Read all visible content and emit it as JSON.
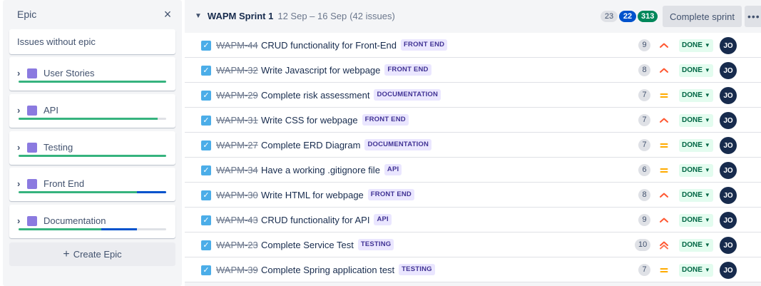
{
  "epic_panel": {
    "title": "Epic",
    "close_icon": "×",
    "no_epic_label": "Issues without epic",
    "epics": [
      {
        "name": "User Stories",
        "color": "#8b7ae0",
        "progress": {
          "done": 1.0,
          "in_progress": 0.0
        }
      },
      {
        "name": "API",
        "color": "#8b7ae0",
        "progress": {
          "done": 0.94,
          "in_progress": 0.0
        }
      },
      {
        "name": "Testing",
        "color": "#8b7ae0",
        "progress": {
          "done": 1.0,
          "in_progress": 0.0
        }
      },
      {
        "name": "Front End",
        "color": "#8b7ae0",
        "progress": {
          "done": 0.8,
          "in_progress": 0.2
        }
      },
      {
        "name": "Documentation",
        "color": "#8b7ae0",
        "progress": {
          "done": 0.56,
          "in_progress": 0.24
        }
      }
    ],
    "create_epic_label": "Create Epic",
    "create_epic_icon": "+"
  },
  "sprint": {
    "name": "WAPM Sprint 1",
    "dates": "12 Sep – 16 Sep",
    "issue_count": "(42 issues)",
    "badges": {
      "todo": "23",
      "in_progress": "22",
      "done": "313"
    },
    "complete_label": "Complete sprint",
    "more_label": "•••"
  },
  "issues": [
    {
      "key": "WAPM-44",
      "summary": "CRUD functionality for Front-End",
      "epic": "FRONT END",
      "points": "9",
      "priority": "high",
      "status": "DONE",
      "assignee": "JO"
    },
    {
      "key": "WAPM-32",
      "summary": "Write Javascript for webpage",
      "epic": "FRONT END",
      "points": "8",
      "priority": "high",
      "status": "DONE",
      "assignee": "JO"
    },
    {
      "key": "WAPM-29",
      "summary": "Complete risk assessment",
      "epic": "DOCUMENTATION",
      "points": "7",
      "priority": "medium",
      "status": "DONE",
      "assignee": "JO"
    },
    {
      "key": "WAPM-31",
      "summary": "Write CSS for webpage",
      "epic": "FRONT END",
      "points": "7",
      "priority": "high",
      "status": "DONE",
      "assignee": "JO"
    },
    {
      "key": "WAPM-27",
      "summary": "Complete ERD Diagram",
      "epic": "DOCUMENTATION",
      "points": "7",
      "priority": "medium",
      "status": "DONE",
      "assignee": "JO"
    },
    {
      "key": "WAPM-34",
      "summary": "Have a working .gitignore file",
      "epic": "API",
      "points": "6",
      "priority": "medium",
      "status": "DONE",
      "assignee": "JO"
    },
    {
      "key": "WAPM-30",
      "summary": "Write HTML for webpage",
      "epic": "FRONT END",
      "points": "8",
      "priority": "high",
      "status": "DONE",
      "assignee": "JO"
    },
    {
      "key": "WAPM-43",
      "summary": "CRUD functionality for API",
      "epic": "API",
      "points": "9",
      "priority": "high",
      "status": "DONE",
      "assignee": "JO"
    },
    {
      "key": "WAPM-23",
      "summary": "Complete Service Test",
      "epic": "TESTING",
      "points": "10",
      "priority": "highest",
      "status": "DONE",
      "assignee": "JO"
    },
    {
      "key": "WAPM-39",
      "summary": "Complete Spring application test",
      "epic": "TESTING",
      "points": "7",
      "priority": "medium",
      "status": "DONE",
      "assignee": "JO"
    }
  ]
}
